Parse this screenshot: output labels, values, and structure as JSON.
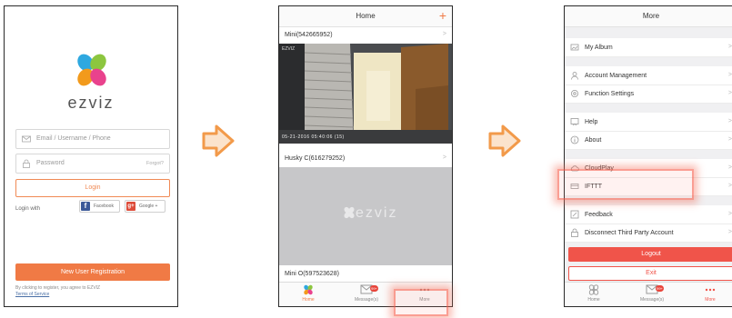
{
  "colors": {
    "accent": "#f07a45",
    "danger": "#f0544a",
    "highlight": "#f5645a"
  },
  "login": {
    "brand": "ezviz",
    "email_placeholder": "Email / Username / Phone",
    "password_placeholder": "Password",
    "forgot": "Forgot?",
    "login_button": "Login",
    "login_with": "Login with",
    "facebook": "Facebook",
    "google": "Google +",
    "new_user": "New User Registration",
    "terms_line": "By clicking to register, you agree to EZVIZ",
    "terms_link": "Terms of Service"
  },
  "home": {
    "title": "Home",
    "cameras": [
      {
        "name": "Mini(542665952)"
      },
      {
        "name": "Husky C(616279252)"
      },
      {
        "name": "Mini O(597523628)"
      }
    ],
    "feed_timestamp": "05-21-2016  05:40:06  (15)",
    "feed_watermark": "EZVIZ",
    "placeholder_brand": "ezviz",
    "tabs": [
      {
        "label": "Home",
        "icon": "home-icon"
      },
      {
        "label": "Message(s)",
        "icon": "message-icon",
        "badge": "99+"
      },
      {
        "label": "More",
        "icon": "more-icon"
      }
    ]
  },
  "more": {
    "title": "More",
    "items": [
      {
        "label": "My Album",
        "icon": "album-icon"
      },
      {
        "label": "Account Management",
        "icon": "account-icon"
      },
      {
        "label": "Function Settings",
        "icon": "settings-icon"
      },
      {
        "label": "Help",
        "icon": "help-icon"
      },
      {
        "label": "About",
        "icon": "info-icon"
      },
      {
        "label": "CloudPlay",
        "icon": "cloud-icon"
      },
      {
        "label": "IFTTT",
        "icon": "ifttt-icon"
      },
      {
        "label": "Feedback",
        "icon": "feedback-icon"
      },
      {
        "label": "Disconnect Third Party Account",
        "icon": "lock-icon"
      }
    ],
    "logout": "Logout",
    "exit": "Exit",
    "tabs": [
      {
        "label": "Home",
        "icon": "home-icon"
      },
      {
        "label": "Message(s)",
        "icon": "message-icon",
        "badge": "99+"
      },
      {
        "label": "More",
        "icon": "more-icon"
      }
    ]
  }
}
